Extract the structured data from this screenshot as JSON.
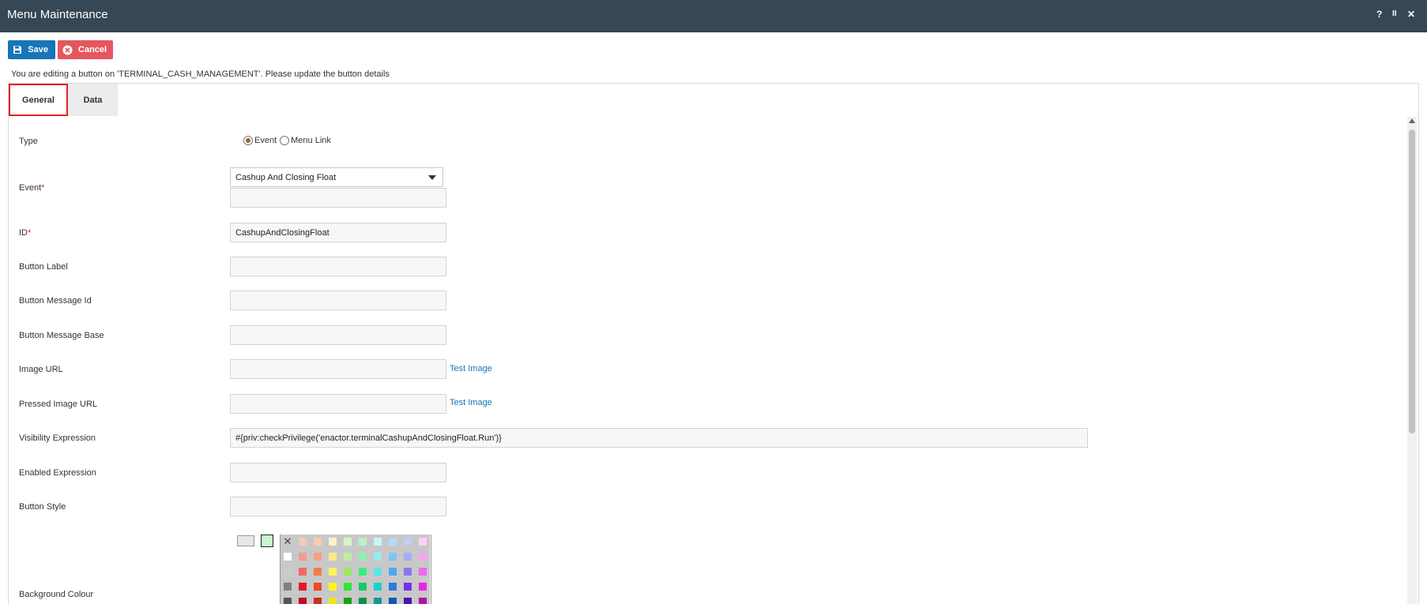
{
  "window": {
    "title": "Menu Maintenance",
    "controls": [
      "?",
      "II",
      "✕"
    ]
  },
  "toolbar": {
    "save_label": "Save",
    "cancel_label": "Cancel"
  },
  "info_text": "You are editing a button on 'TERMINAL_CASH_MANAGEMENT'. Please update the button details",
  "tabs": [
    {
      "label": "General",
      "selected": true
    },
    {
      "label": "Data",
      "selected": false
    }
  ],
  "form": {
    "type": {
      "label": "Type",
      "options": [
        {
          "label": "Event",
          "checked": true
        },
        {
          "label": "Menu Link",
          "checked": false
        }
      ]
    },
    "event": {
      "label": "Event",
      "required_mark": "*",
      "selected": "Cashup And Closing Float",
      "extra_value": ""
    },
    "id": {
      "label": "ID",
      "required_mark": "*",
      "value": "CashupAndClosingFloat"
    },
    "button_label": {
      "label": "Button Label",
      "value": ""
    },
    "button_message_id": {
      "label": "Button Message Id",
      "value": ""
    },
    "button_message_base": {
      "label": "Button Message Base",
      "value": ""
    },
    "image_url": {
      "label": "Image URL",
      "value": "",
      "link": "Test Image"
    },
    "pressed_image_url": {
      "label": "Pressed Image URL",
      "value": "",
      "link": "Test Image"
    },
    "visibility_expression": {
      "label": "Visibility Expression",
      "value": "#{priv:checkPrivilege('enactor.terminalCashupAndClosingFloat.Run')}"
    },
    "enabled_expression": {
      "label": "Enabled Expression",
      "value": ""
    },
    "button_style": {
      "label": "Button Style",
      "value": ""
    },
    "background_colour": {
      "label": "Background Colour",
      "current_swatches": [
        "#e8e8e8",
        "#c8f5cc"
      ],
      "palette_rows": [
        [
          "none",
          "#f4c7c3",
          "#fcc9b3",
          "#fff2c2",
          "#d9f2c7",
          "#b7f2c8",
          "#c4f6f6",
          "#b3dafb",
          "#c7ccf5",
          "#fad0f5"
        ],
        [
          "#ffffff",
          "#f59b95",
          "#f7a17f",
          "#ffe989",
          "#c0ed9e",
          "#8ef1b1",
          "#95eeee",
          "#85c4f4",
          "#a5aef0",
          "#f4a6ee"
        ],
        [
          "#cccccc",
          "#f06b62",
          "#f47b4c",
          "#fff35d",
          "#9aea5f",
          "#39ec7e",
          "#58e8e8",
          "#4ea7f2",
          "#8479ec",
          "#ef68ec"
        ],
        [
          "#808080",
          "#e5172e",
          "#ef4727",
          "#fff41d",
          "#32e632",
          "#13cf61",
          "#16d1d1",
          "#2b79e3",
          "#7532e8",
          "#e826e8"
        ],
        [
          "#555555",
          "#c20c1f",
          "#c9301a",
          "#f1e31a",
          "#16a316",
          "#0b9447",
          "#109999",
          "#1557b0",
          "#4d14a6",
          "#b0139e"
        ]
      ]
    }
  }
}
